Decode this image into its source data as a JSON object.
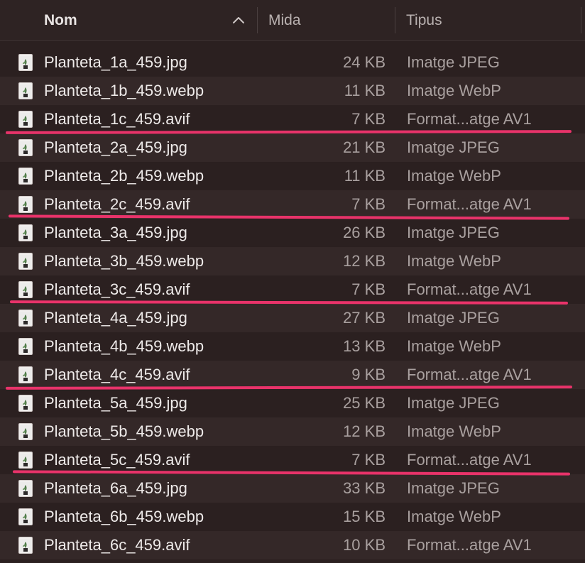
{
  "header": {
    "name_label": "Nom",
    "size_label": "Mida",
    "kind_label": "Tipus",
    "sort_icon": "chevron-up-icon"
  },
  "colors": {
    "background": "#2b2020",
    "row_alt": "#342828",
    "highlight": "#e8336a"
  },
  "files": [
    {
      "name": "Planteta_1a_459.jpg",
      "size": "24 KB",
      "kind": "Imatge JPEG",
      "icon": "image-thumbnail-icon"
    },
    {
      "name": "Planteta_1b_459.webp",
      "size": "11 KB",
      "kind": "Imatge WebP",
      "icon": "image-thumbnail-icon"
    },
    {
      "name": "Planteta_1c_459.avif",
      "size": "7 KB",
      "kind": "Format...atge AV1",
      "icon": "image-thumbnail-icon",
      "highlighted": true
    },
    {
      "name": "Planteta_2a_459.jpg",
      "size": "21 KB",
      "kind": "Imatge JPEG",
      "icon": "image-thumbnail-icon"
    },
    {
      "name": "Planteta_2b_459.webp",
      "size": "11 KB",
      "kind": "Imatge WebP",
      "icon": "image-thumbnail-icon"
    },
    {
      "name": "Planteta_2c_459.avif",
      "size": "7 KB",
      "kind": "Format...atge AV1",
      "icon": "image-thumbnail-icon",
      "highlighted": true
    },
    {
      "name": "Planteta_3a_459.jpg",
      "size": "26 KB",
      "kind": "Imatge JPEG",
      "icon": "image-thumbnail-icon"
    },
    {
      "name": "Planteta_3b_459.webp",
      "size": "12 KB",
      "kind": "Imatge WebP",
      "icon": "image-thumbnail-icon"
    },
    {
      "name": "Planteta_3c_459.avif",
      "size": "7 KB",
      "kind": "Format...atge AV1",
      "icon": "image-thumbnail-icon",
      "highlighted": true
    },
    {
      "name": "Planteta_4a_459.jpg",
      "size": "27 KB",
      "kind": "Imatge JPEG",
      "icon": "image-thumbnail-icon"
    },
    {
      "name": "Planteta_4b_459.webp",
      "size": "13 KB",
      "kind": "Imatge WebP",
      "icon": "image-thumbnail-icon"
    },
    {
      "name": "Planteta_4c_459.avif",
      "size": "9 KB",
      "kind": "Format...atge AV1",
      "icon": "image-thumbnail-icon",
      "highlighted": true
    },
    {
      "name": "Planteta_5a_459.jpg",
      "size": "25 KB",
      "kind": "Imatge JPEG",
      "icon": "image-thumbnail-icon"
    },
    {
      "name": "Planteta_5b_459.webp",
      "size": "12 KB",
      "kind": "Imatge WebP",
      "icon": "image-thumbnail-icon"
    },
    {
      "name": "Planteta_5c_459.avif",
      "size": "7 KB",
      "kind": "Format...atge AV1",
      "icon": "image-thumbnail-icon",
      "highlighted": true
    },
    {
      "name": "Planteta_6a_459.jpg",
      "size": "33 KB",
      "kind": "Imatge JPEG",
      "icon": "image-thumbnail-icon"
    },
    {
      "name": "Planteta_6b_459.webp",
      "size": "15 KB",
      "kind": "Imatge WebP",
      "icon": "image-thumbnail-icon"
    },
    {
      "name": "Planteta_6c_459.avif",
      "size": "10 KB",
      "kind": "Format...atge AV1",
      "icon": "image-thumbnail-icon"
    }
  ]
}
